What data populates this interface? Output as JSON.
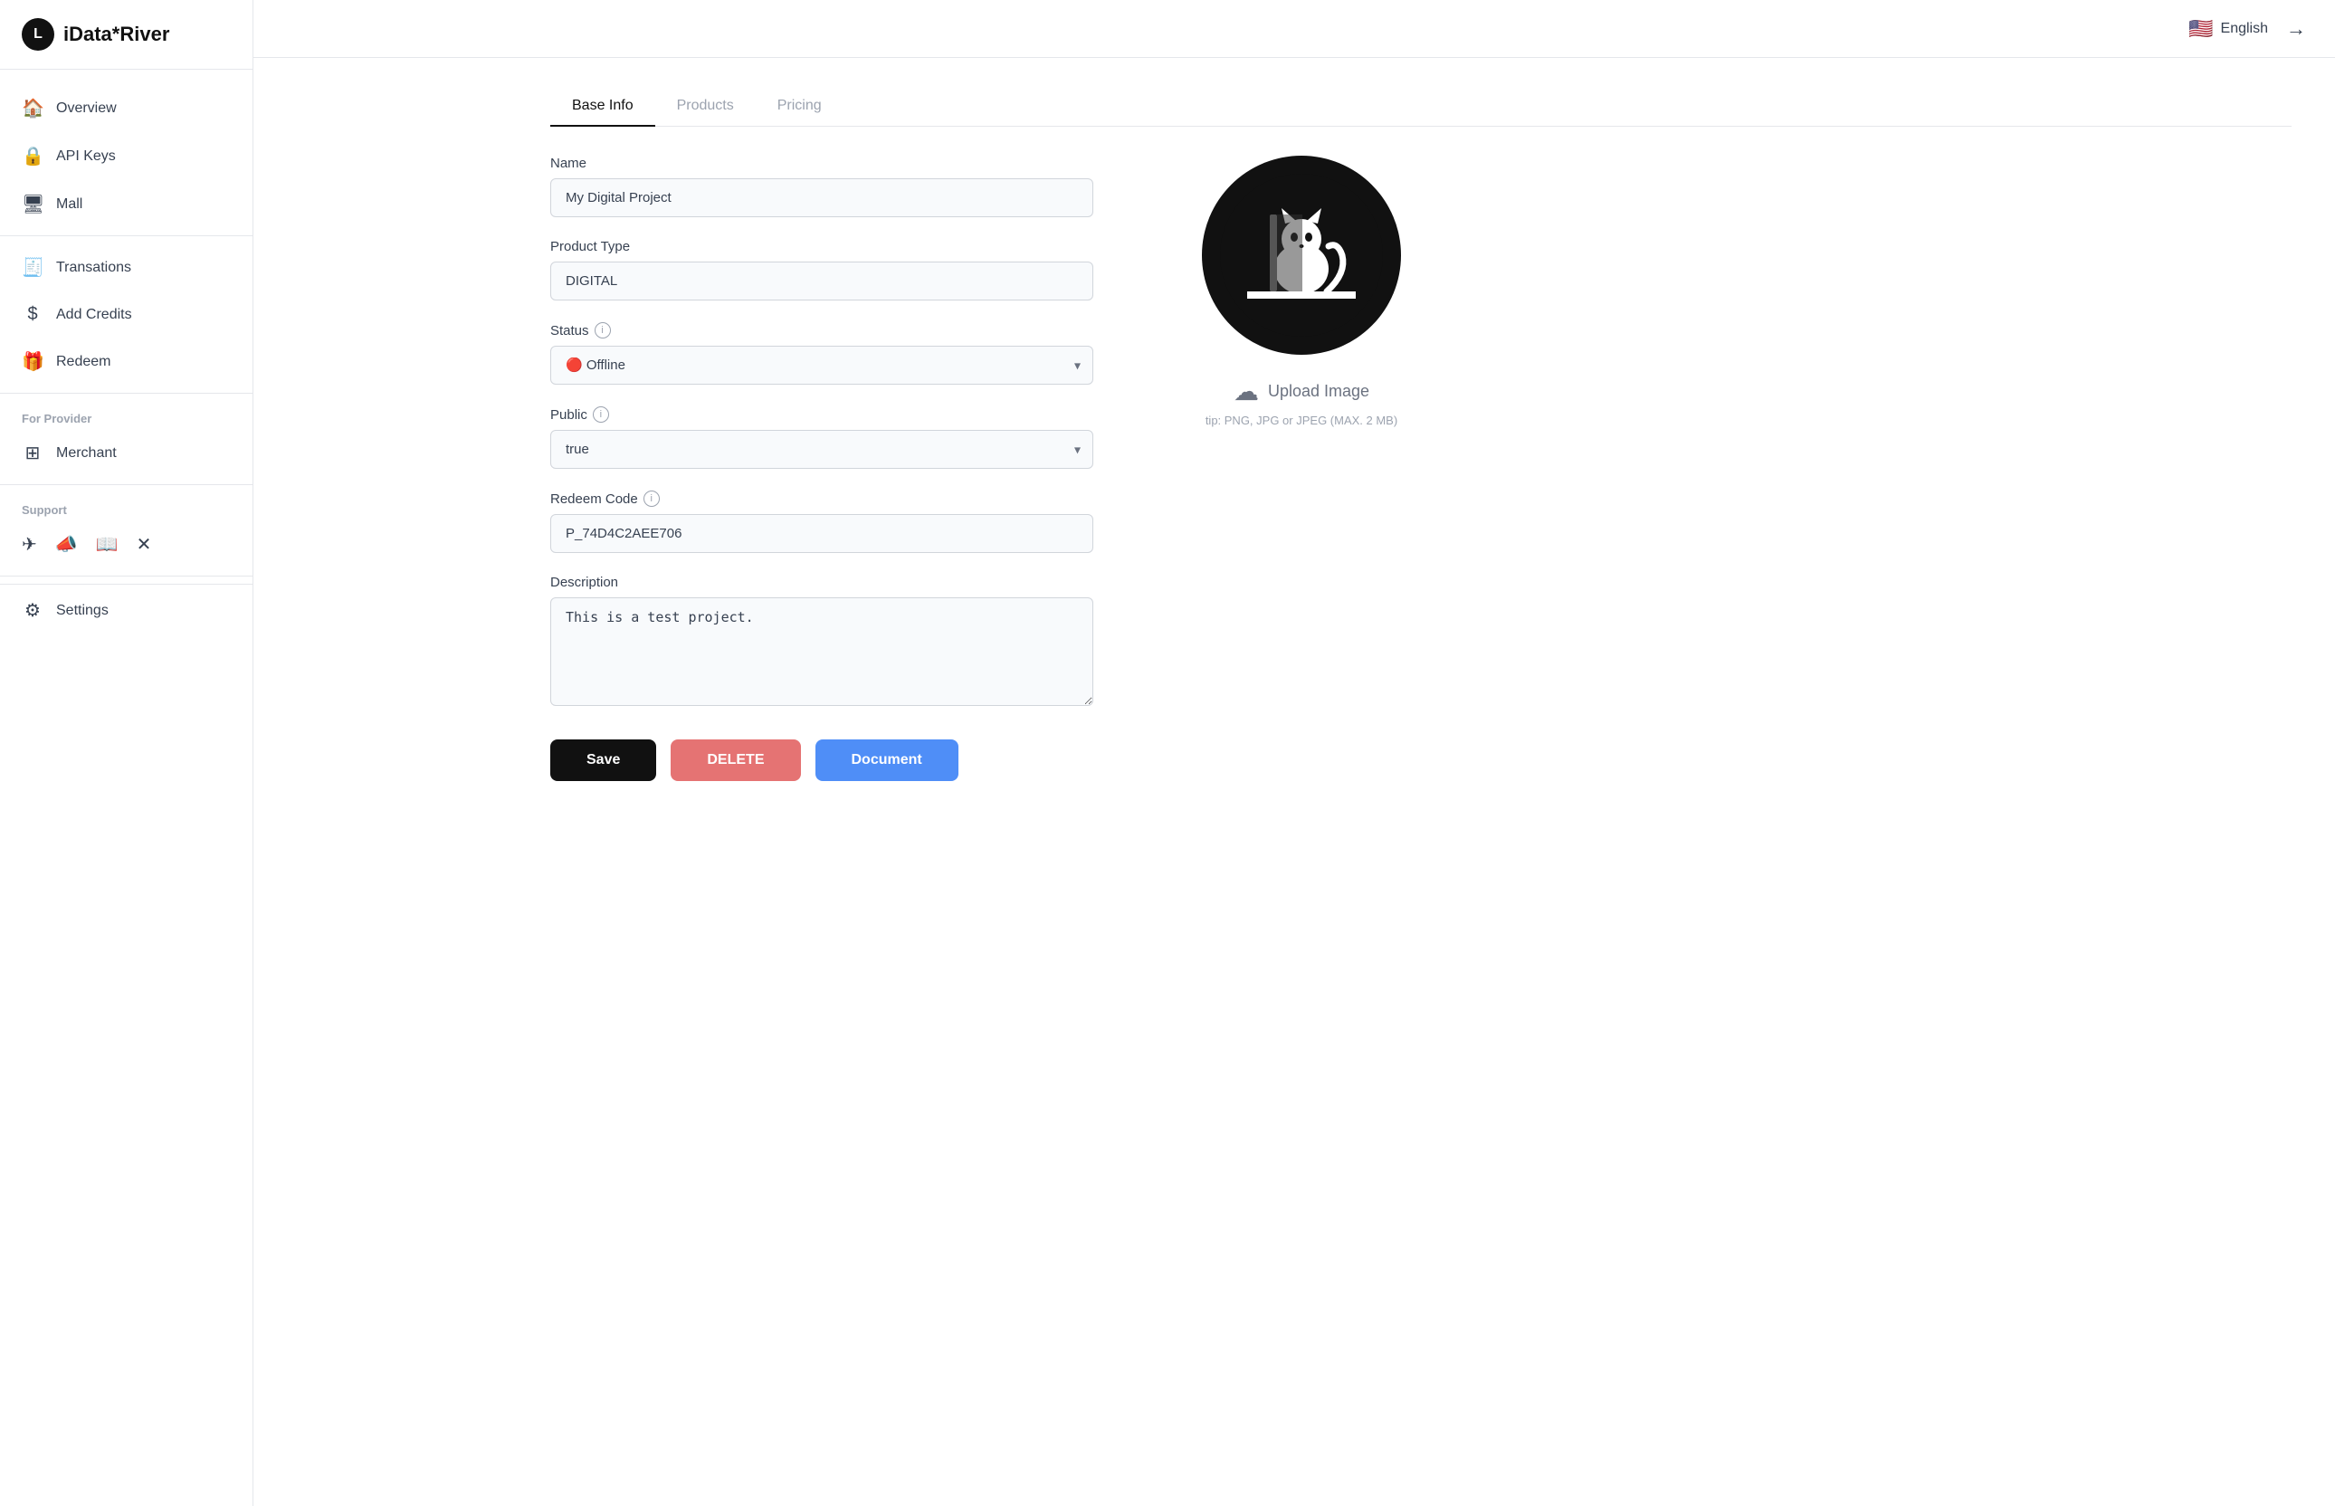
{
  "app": {
    "name": "iData",
    "star": "*",
    "river": "River",
    "logo_letter": "L"
  },
  "header": {
    "language": "English",
    "logout_icon": "→"
  },
  "sidebar": {
    "nav_items": [
      {
        "id": "overview",
        "label": "Overview",
        "icon": "🏠"
      },
      {
        "id": "api-keys",
        "label": "API Keys",
        "icon": "🔒"
      },
      {
        "id": "mall",
        "label": "Mall",
        "icon": "🖥"
      }
    ],
    "provider_label": "For Provider",
    "provider_items": [
      {
        "id": "transations",
        "label": "Transations",
        "icon": "🧾"
      },
      {
        "id": "add-credits",
        "label": "Add Credits",
        "icon": "💲"
      },
      {
        "id": "redeem",
        "label": "Redeem",
        "icon": "🎁"
      }
    ],
    "merchant_item": {
      "id": "merchant",
      "label": "Merchant",
      "icon": "⊞"
    },
    "support_label": "Support",
    "support_icons": [
      {
        "id": "telegram",
        "symbol": "✈"
      },
      {
        "id": "announcement",
        "symbol": "📣"
      },
      {
        "id": "book",
        "symbol": "📖"
      },
      {
        "id": "twitter",
        "symbol": "✕"
      }
    ],
    "settings_item": {
      "id": "settings",
      "label": "Settings",
      "icon": "⚙"
    }
  },
  "tabs": [
    {
      "id": "base-info",
      "label": "Base Info",
      "active": true
    },
    {
      "id": "products",
      "label": "Products",
      "active": false
    },
    {
      "id": "pricing",
      "label": "Pricing",
      "active": false
    }
  ],
  "form": {
    "name_label": "Name",
    "name_value": "My Digital Project",
    "product_type_label": "Product Type",
    "product_type_value": "DIGITAL",
    "status_label": "Status",
    "status_value": "Offline",
    "status_dot": "●",
    "public_label": "Public",
    "public_value": "true",
    "redeem_code_label": "Redeem Code",
    "redeem_code_value": "P_74D4C2AEE706",
    "description_label": "Description",
    "description_value": "This is a test project.",
    "save_label": "Save",
    "delete_label": "DELETE",
    "document_label": "Document"
  },
  "image": {
    "upload_label": "Upload Image",
    "upload_tip": "tip: PNG, JPG or JPEG (MAX. 2 MB)"
  }
}
